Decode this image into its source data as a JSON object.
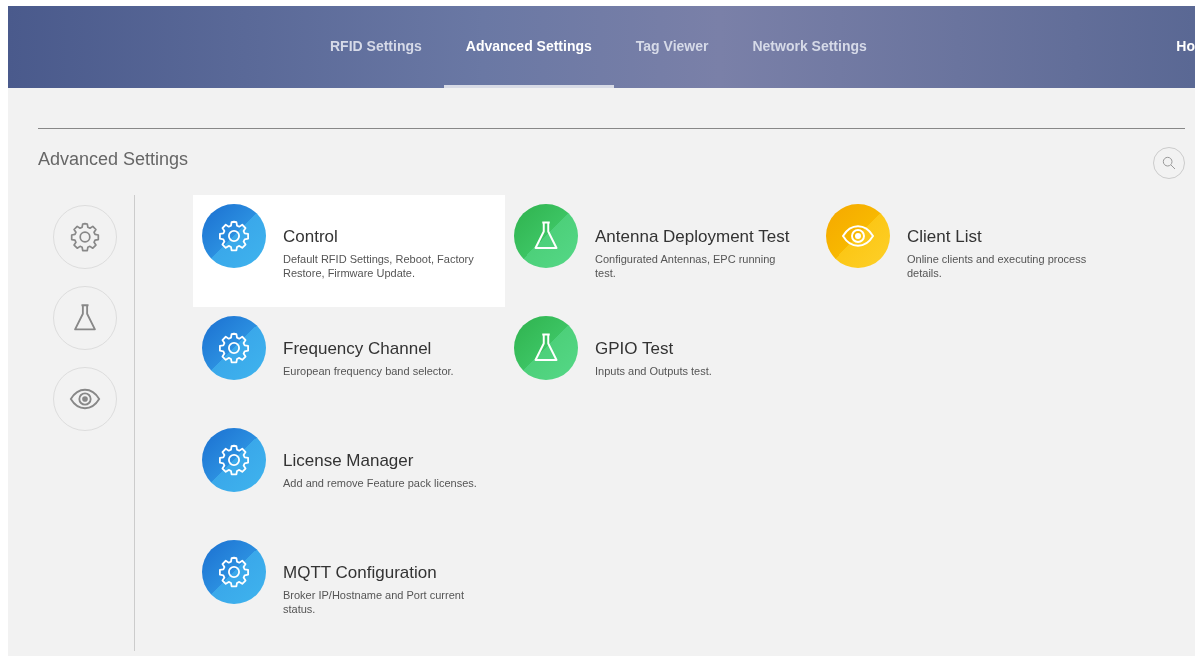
{
  "nav": {
    "tabs": [
      {
        "label": "RFID Settings",
        "selected": false
      },
      {
        "label": "Advanced Settings",
        "selected": true
      },
      {
        "label": "Tag Viewer",
        "selected": false
      },
      {
        "label": "Network Settings",
        "selected": false
      }
    ],
    "edge_link": "Ho"
  },
  "page": {
    "title": "Advanced Settings"
  },
  "filters": [
    {
      "kind": "gear"
    },
    {
      "kind": "flask"
    },
    {
      "kind": "eye"
    }
  ],
  "columns": [
    {
      "kind": "gear",
      "items": [
        {
          "title": "Control",
          "description": "Default RFID Settings, Reboot, Factory Restore, Firmware Update.",
          "selected": true
        },
        {
          "title": "Frequency Channel",
          "description": "European frequency band selector.",
          "selected": false
        },
        {
          "title": "License Manager",
          "description": "Add and remove Feature pack licenses.",
          "selected": false
        },
        {
          "title": "MQTT Configuration",
          "description": "Broker IP/Hostname and Port current status.",
          "selected": false
        }
      ]
    },
    {
      "kind": "flask",
      "items": [
        {
          "title": "Antenna Deployment Test",
          "description": "Configurated Antennas, EPC running test.",
          "selected": false
        },
        {
          "title": "GPIO Test",
          "description": "Inputs and Outputs test.",
          "selected": false
        }
      ]
    },
    {
      "kind": "eye",
      "items": [
        {
          "title": "Client List",
          "description": "Online clients and executing process details.",
          "selected": false
        }
      ]
    }
  ]
}
